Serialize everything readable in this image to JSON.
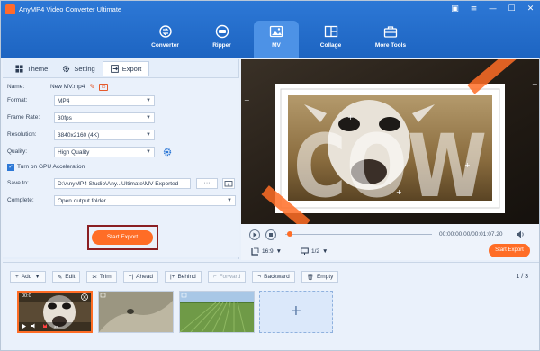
{
  "app": {
    "title": "AnyMP4 Video Converter Ultimate"
  },
  "window_controls": [
    "▣",
    "≡",
    "—",
    "☐",
    "✕"
  ],
  "main_tabs": [
    {
      "label": "Converter",
      "icon": "converter-icon"
    },
    {
      "label": "Ripper",
      "icon": "ripper-icon"
    },
    {
      "label": "MV",
      "icon": "mv-icon",
      "active": true
    },
    {
      "label": "Collage",
      "icon": "collage-icon"
    },
    {
      "label": "More Tools",
      "icon": "toolbox-icon"
    }
  ],
  "sub_tabs": [
    {
      "label": "Theme",
      "icon": "theme-icon"
    },
    {
      "label": "Setting",
      "icon": "gear-icon"
    },
    {
      "label": "Export",
      "icon": "export-icon",
      "active": true
    }
  ],
  "export": {
    "name_label": "Name:",
    "name_value": "New MV.mp4",
    "format_label": "Format:",
    "format_value": "MP4",
    "frame_rate_label": "Frame Rate:",
    "frame_rate_value": "30fps",
    "resolution_label": "Resolution:",
    "resolution_value": "3840x2160 (4K)",
    "quality_label": "Quality:",
    "quality_value": "High Quality",
    "gpu_label": "Turn on GPU Acceleration",
    "gpu_checked": true,
    "save_to_label": "Save to:",
    "save_to_value": "D:\\AnyMP4 Studio\\Any...Ultimate\\MV Exported",
    "dots": "···",
    "complete_label": "Complete:",
    "complete_value": "Open output folder",
    "start_button": "Start Export"
  },
  "player": {
    "time": "00:00:00.00/00:01:07.20",
    "ratio": "16:9",
    "page": "1/2",
    "start_button": "Start Export"
  },
  "preview_text": "COW",
  "toolbar": {
    "add": "Add",
    "edit": "Edit",
    "trim": "Trim",
    "ahead": "Ahead",
    "behind": "Behind",
    "forward": "Forward",
    "backward": "Backward",
    "empty": "Empty",
    "page_count": "1 / 3"
  },
  "thumb_time": "00:0",
  "colors": {
    "accent": "#ff6d26",
    "brand_blue": "#2d78d6"
  }
}
